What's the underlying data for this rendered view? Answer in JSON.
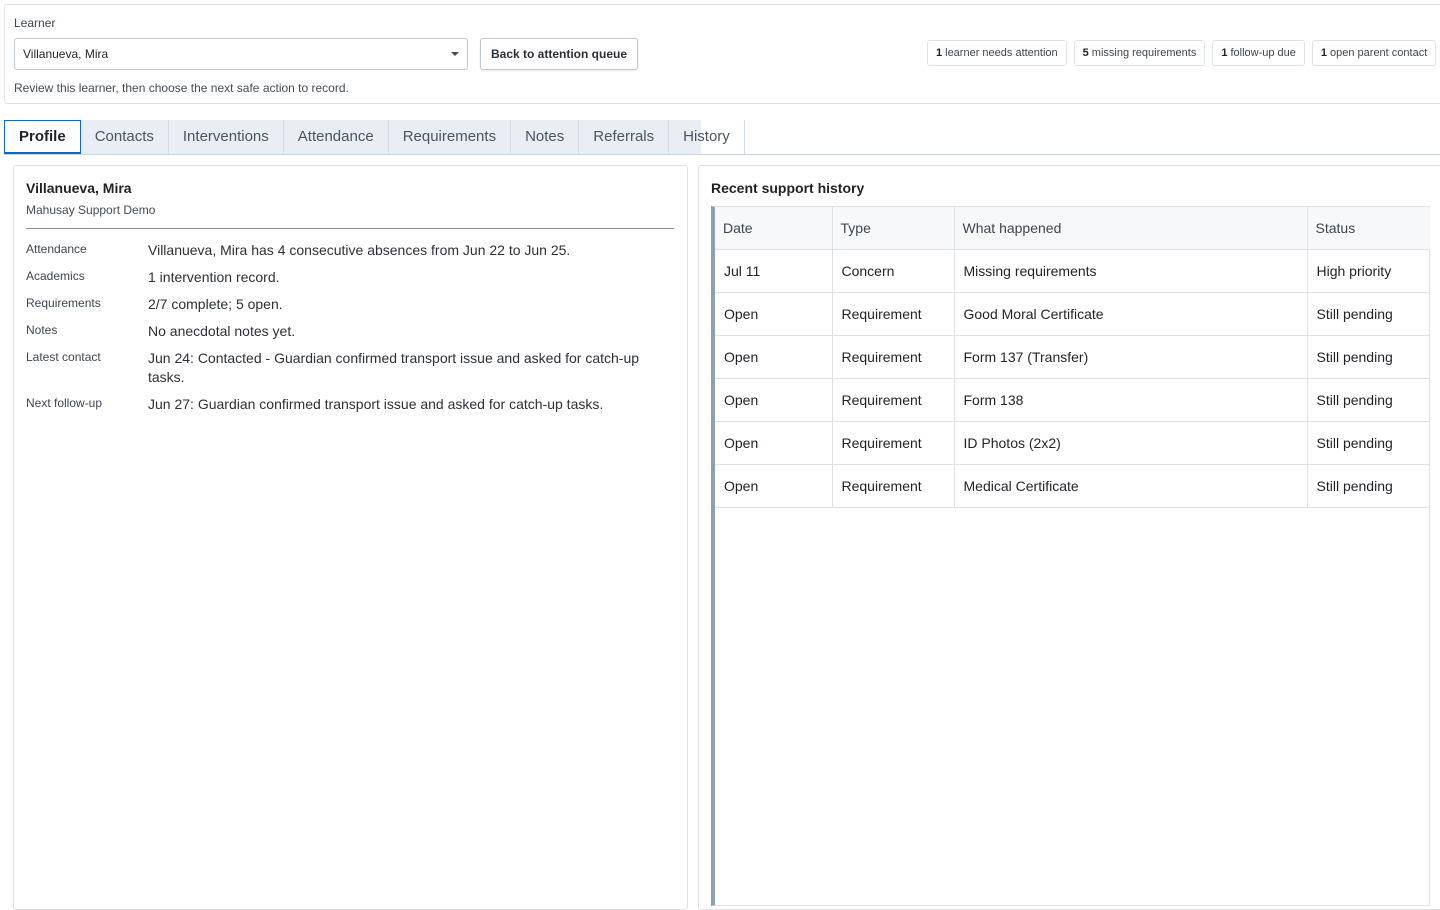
{
  "header": {
    "learner_label": "Learner",
    "learner_select_value": "Villanueva, Mira",
    "back_button_label": "Back to attention queue",
    "hint": "Review this learner, then choose the next safe action to record.",
    "badges": [
      {
        "count": "1",
        "label": "learner needs attention"
      },
      {
        "count": "5",
        "label": "missing requirements"
      },
      {
        "count": "1",
        "label": "follow-up due"
      },
      {
        "count": "1",
        "label": "open parent contact"
      }
    ]
  },
  "tabs": [
    {
      "label": "Profile",
      "active": true
    },
    {
      "label": "Contacts",
      "active": false
    },
    {
      "label": "Interventions",
      "active": false
    },
    {
      "label": "Attendance",
      "active": false
    },
    {
      "label": "Requirements",
      "active": false
    },
    {
      "label": "Notes",
      "active": false
    },
    {
      "label": "Referrals",
      "active": false
    },
    {
      "label": "History",
      "active": false
    }
  ],
  "profile": {
    "name": "Villanueva, Mira",
    "school": "Mahusay Support Demo",
    "rows": [
      {
        "key": "Attendance",
        "value": "Villanueva, Mira has 4 consecutive absences from Jun 22 to Jun 25."
      },
      {
        "key": "Academics",
        "value": "1 intervention record."
      },
      {
        "key": "Requirements",
        "value": "2/7 complete; 5 open."
      },
      {
        "key": "Notes",
        "value": "No anecdotal notes yet."
      },
      {
        "key": "Latest contact",
        "value": "Jun 24: Contacted - Guardian confirmed transport issue and asked for catch-up tasks."
      },
      {
        "key": "Next follow-up",
        "value": "Jun 27: Guardian confirmed transport issue and asked for catch-up tasks."
      }
    ]
  },
  "history": {
    "title": "Recent support history",
    "columns": [
      "Date",
      "Type",
      "What happened",
      "Status"
    ],
    "rows": [
      [
        "Jul 11",
        "Concern",
        "Missing requirements",
        "High priority"
      ],
      [
        "Open",
        "Requirement",
        "Good Moral Certificate",
        "Still pending"
      ],
      [
        "Open",
        "Requirement",
        "Form 137 (Transfer)",
        "Still pending"
      ],
      [
        "Open",
        "Requirement",
        "Form 138",
        "Still pending"
      ],
      [
        "Open",
        "Requirement",
        "ID Photos (2x2)",
        "Still pending"
      ],
      [
        "Open",
        "Requirement",
        "Medical Certificate",
        "Still pending"
      ]
    ]
  }
}
